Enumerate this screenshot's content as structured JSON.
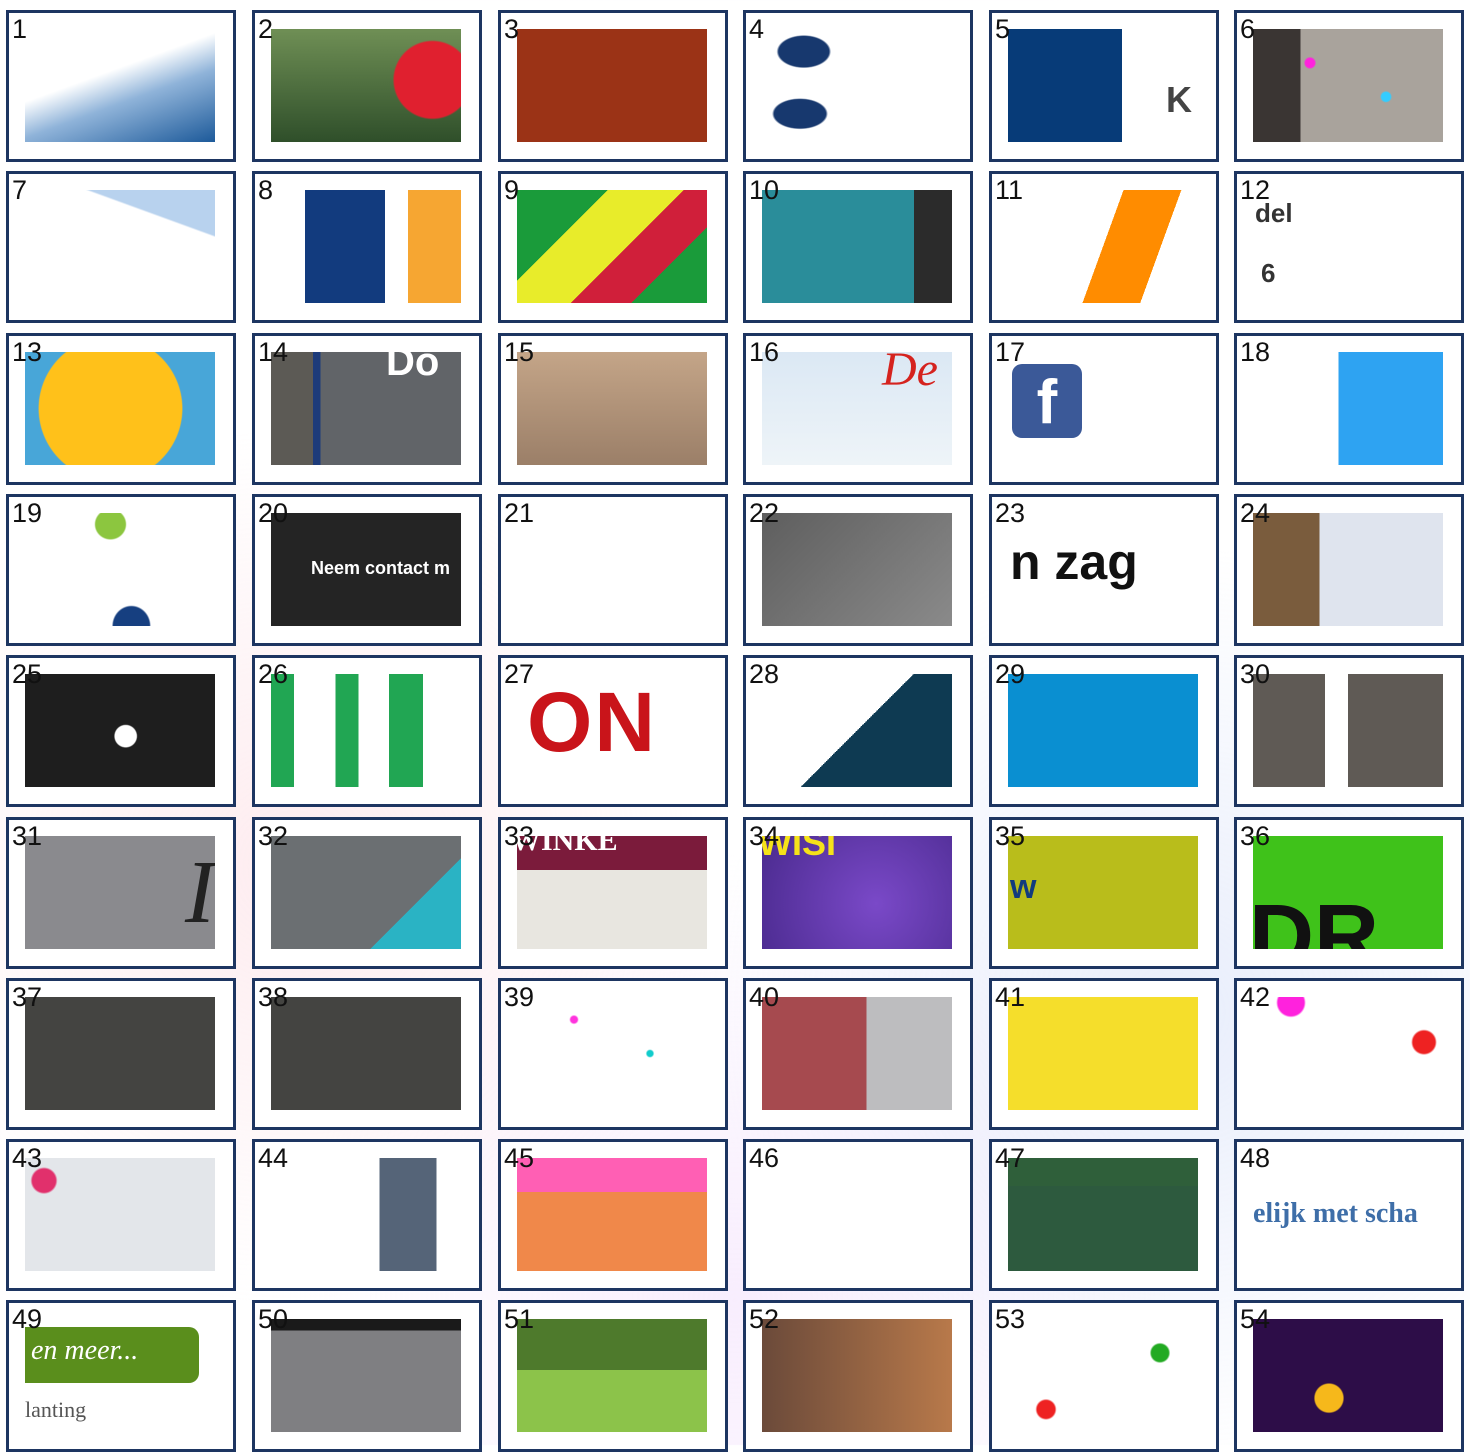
{
  "grid_title": "",
  "thumbnails": [
    {
      "number": "1",
      "text": "",
      "icon": "blue-triangle-shape"
    },
    {
      "number": "2",
      "text": "",
      "icon": "red-balloon-trees-photo"
    },
    {
      "number": "3",
      "text": "",
      "icon": "rust-text-crop"
    },
    {
      "number": "4",
      "text": "",
      "icon": "navy-colon-dots"
    },
    {
      "number": "5",
      "text": "K",
      "icon": "navy-square-crop"
    },
    {
      "number": "6",
      "text": "",
      "icon": "confetti-jacket-photo"
    },
    {
      "number": "7",
      "text": "",
      "icon": "blue-bevel-shape"
    },
    {
      "number": "8",
      "text": "",
      "icon": "navy-orange-blocks"
    },
    {
      "number": "9",
      "text": "",
      "icon": "colorful-letters-poster"
    },
    {
      "number": "10",
      "text": "",
      "icon": "teal-shirt-photo"
    },
    {
      "number": "11",
      "text": "",
      "icon": "orange-stroke-shape"
    },
    {
      "number": "12",
      "text": "del",
      "text2": "6",
      "icon": "text-crop"
    },
    {
      "number": "13",
      "text": "",
      "icon": "yellow-balloon-photo"
    },
    {
      "number": "14",
      "text": "Do",
      "icon": "grey-sign-photo"
    },
    {
      "number": "15",
      "text": "",
      "icon": "skin-closeup-photo"
    },
    {
      "number": "16",
      "text": "De",
      "icon": "sky-plants-illustration"
    },
    {
      "number": "17",
      "text": "",
      "icon": "facebook-icon"
    },
    {
      "number": "18",
      "text": "",
      "icon": "blue-rounded-shape"
    },
    {
      "number": "19",
      "text": "",
      "icon": "green-blue-dots"
    },
    {
      "number": "20",
      "text": "Neem contact m",
      "icon": "dark-text-banner"
    },
    {
      "number": "21",
      "text": "",
      "icon": "line-drawing"
    },
    {
      "number": "22",
      "text": "",
      "icon": "grey-hands-photo"
    },
    {
      "number": "23",
      "text": "n zag",
      "icon": "bold-text-crop"
    },
    {
      "number": "24",
      "text": "",
      "icon": "arm-photo"
    },
    {
      "number": "25",
      "text": "",
      "icon": "black-pattern-logo"
    },
    {
      "number": "26",
      "text": "",
      "icon": "green-letters-logo"
    },
    {
      "number": "27",
      "text": "ON",
      "icon": "red-blue-text-logo"
    },
    {
      "number": "28",
      "text": "",
      "icon": "navy-triangle-shape"
    },
    {
      "number": "29",
      "text": "",
      "icon": "blue-panel"
    },
    {
      "number": "30",
      "text": "",
      "icon": "grey-blocks-logo"
    },
    {
      "number": "31",
      "text": "I",
      "icon": "grey-panel"
    },
    {
      "number": "32",
      "text": "",
      "icon": "grey-teal-photo"
    },
    {
      "number": "33",
      "text": "WINKE",
      "icon": "colorful-arch-photo"
    },
    {
      "number": "34",
      "text": "WISI",
      "icon": "purple-poster"
    },
    {
      "number": "35",
      "text": "w",
      "icon": "olive-panel"
    },
    {
      "number": "36",
      "text": "DR",
      "icon": "green-letters-poster"
    },
    {
      "number": "37",
      "text": "",
      "icon": "dark-confetti"
    },
    {
      "number": "38",
      "text": "",
      "icon": "dark-confetti"
    },
    {
      "number": "39",
      "text": "",
      "icon": "white-confetti"
    },
    {
      "number": "40",
      "text": "",
      "icon": "red-grey-blocks"
    },
    {
      "number": "41",
      "text": "",
      "icon": "yellow-illustration"
    },
    {
      "number": "42",
      "text": "",
      "icon": "white-confetti"
    },
    {
      "number": "43",
      "text": "",
      "icon": "light-confetti"
    },
    {
      "number": "44",
      "text": "",
      "icon": "grey-column-photo"
    },
    {
      "number": "45",
      "text": "",
      "icon": "pink-orange-illustration"
    },
    {
      "number": "46",
      "text": "",
      "icon": "line-drawing-face"
    },
    {
      "number": "47",
      "text": "",
      "icon": "green-field-photo"
    },
    {
      "number": "48",
      "text": "elijk met scha",
      "icon": "blue-text-crop"
    },
    {
      "number": "49",
      "text": "en meer...",
      "text2": "lanting",
      "icon": "green-label-crop"
    },
    {
      "number": "50",
      "text": "",
      "icon": "grey-pavement-photo"
    },
    {
      "number": "51",
      "text": "",
      "icon": "garden-hedge-photo"
    },
    {
      "number": "52",
      "text": "",
      "icon": "food-closeup-photo"
    },
    {
      "number": "53",
      "text": "",
      "icon": "streamers-confetti"
    },
    {
      "number": "54",
      "text": "",
      "icon": "dark-purple-confetti"
    }
  ]
}
